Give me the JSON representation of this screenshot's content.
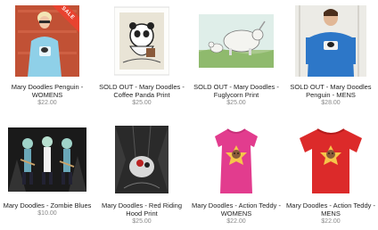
{
  "products": [
    {
      "title": "Mary Doodles Penguin - WOMENS",
      "price": "$22.00",
      "badge": "SALE",
      "image": "woman-wearing-penguin-shirt"
    },
    {
      "title": "SOLD OUT - Mary Doodles - Coffee Panda Print",
      "price": "$25.00",
      "image": "coffee-panda-print"
    },
    {
      "title": "SOLD OUT - Mary Doodles - Fuglycorn Print",
      "price": "$25.00",
      "image": "fuglycorn-print"
    },
    {
      "title": "SOLD OUT - Mary Doodles Penguin - MENS",
      "price": "$28.00",
      "image": "man-wearing-penguin-shirt"
    },
    {
      "title": "Mary Doodles - Zombie Blues",
      "price": "$10.00",
      "image": "zombie-blues-art"
    },
    {
      "title": "Mary Doodles - Red Riding Hood Print",
      "price": "$25.00",
      "image": "red-riding-hood-print"
    },
    {
      "title": "Mary Doodles - Action Teddy - WOMENS",
      "price": "$22.00",
      "image": "pink-teddy-shirt"
    },
    {
      "title": "Mary Doodles - Action Teddy - MENS",
      "price": "$22.00",
      "image": "red-teddy-shirt"
    }
  ]
}
